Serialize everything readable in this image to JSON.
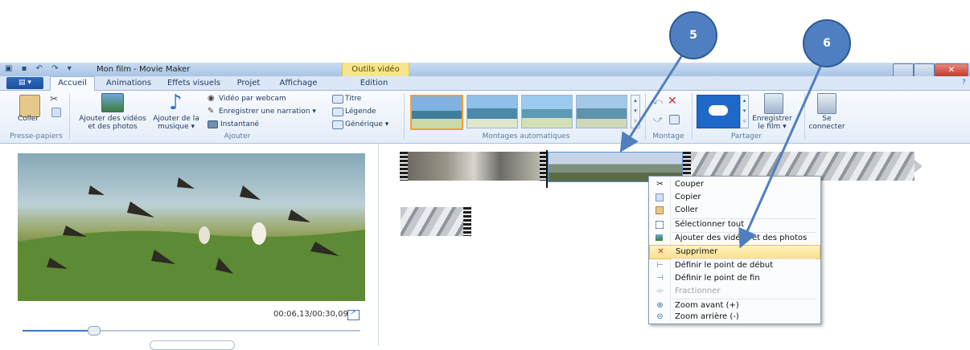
{
  "window": {
    "title": "Mon film - Movie Maker",
    "contextual_tab_group": "Outils vidéo"
  },
  "tabs": [
    "Accueil",
    "Animations",
    "Effets visuels",
    "Projet",
    "Affichage",
    "Edition"
  ],
  "ribbon": {
    "clipboard": {
      "paste": "Coller",
      "group": "Presse-papiers"
    },
    "add": {
      "add_videos_line1": "Ajouter des vidéos",
      "add_videos_line2": "et des photos",
      "add_music_line1": "Ajouter de la",
      "add_music_line2": "musique ▾",
      "webcam": "Vidéo par webcam",
      "narration": "Enregistrer une narration ▾",
      "snapshot": "Instantané",
      "title": "Titre",
      "caption": "Légende",
      "credits": "Générique ▾",
      "group": "Ajouter"
    },
    "auto_movies": {
      "group": "Montages automatiques"
    },
    "editing": {
      "group": "Montage"
    },
    "share": {
      "save_line1": "Enregistrer",
      "save_line2": "le film ▾",
      "group": "Partager"
    },
    "signin": {
      "line1": "Se",
      "line2": "connecter"
    }
  },
  "preview": {
    "timecode": "00:06,13/00:30,09",
    "progress_fraction": 0.21
  },
  "context_menu": {
    "items": [
      {
        "label": "Couper",
        "icon": "scissors-icon"
      },
      {
        "label": "Copier",
        "icon": "copy-icon"
      },
      {
        "label": "Coller",
        "icon": "paste-icon"
      },
      {
        "label": "Sélectionner tout",
        "icon": "select-all-icon"
      },
      {
        "label": "Ajouter des vidéos et des photos",
        "icon": "add-media-icon"
      },
      {
        "label": "Supprimer",
        "icon": "delete-icon"
      },
      {
        "label": "Définir le point de début",
        "icon": "set-start-icon"
      },
      {
        "label": "Définir le point de fin",
        "icon": "set-end-icon"
      },
      {
        "label": "Fractionner",
        "icon": "split-icon"
      },
      {
        "label": "Zoom avant (+)",
        "icon": "zoom-in-icon"
      },
      {
        "label": "Zoom arrière (-)",
        "icon": "zoom-out-icon"
      }
    ]
  },
  "callouts": [
    "5",
    "6"
  ],
  "colors": {
    "accent": "#3a78c8",
    "highlight": "#fbe18c",
    "callout": "#4f7fc0",
    "delete_red": "#d22a2a"
  }
}
